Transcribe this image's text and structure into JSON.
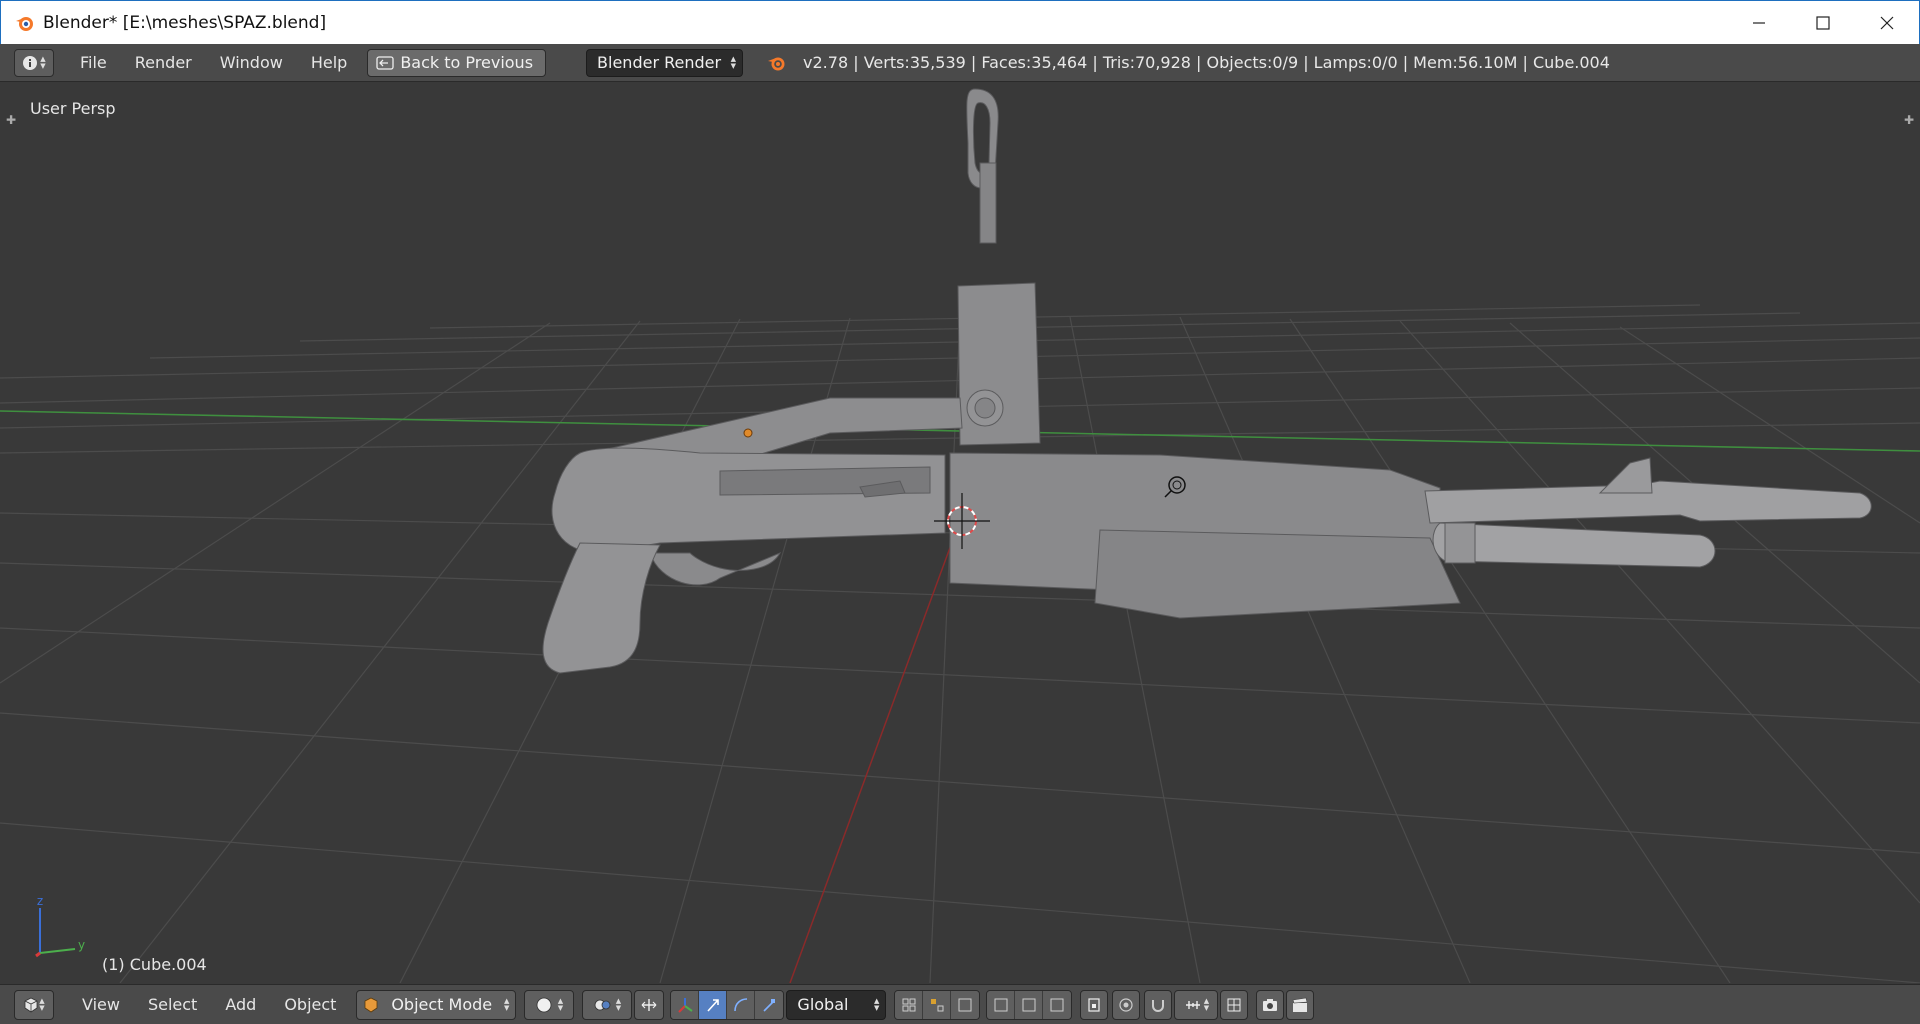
{
  "window": {
    "title": "Blender* [E:\\meshes\\SPAZ.blend]"
  },
  "info_header": {
    "menus": [
      "File",
      "Render",
      "Window",
      "Help"
    ],
    "back_button": "Back to Previous",
    "render_engine": "Blender Render",
    "stats": "v2.78 | Verts:35,539 | Faces:35,464 | Tris:70,928 | Objects:0/9 | Lamps:0/0 | Mem:56.10M | Cube.004"
  },
  "viewport": {
    "view_name": "User Persp",
    "active_object_label": "(1) Cube.004",
    "axis_labels": {
      "z": "z",
      "y": "y"
    }
  },
  "view_header": {
    "menus": [
      "View",
      "Select",
      "Add",
      "Object"
    ],
    "mode": "Object Mode",
    "transform_orientation": "Global"
  },
  "colors": {
    "viewport_bg": "#393939",
    "header_bg": "#4a4a4a",
    "grid": "#4b4b4b",
    "x_axis": "#8a2a2a",
    "y_axis": "#3f8f3f",
    "mesh": "#8e8e90",
    "selection_accent": "#5680c2"
  }
}
